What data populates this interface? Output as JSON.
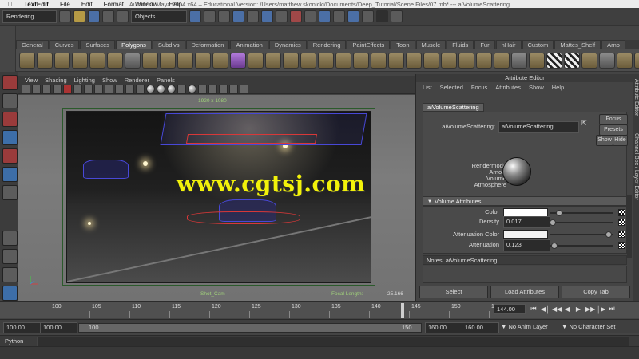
{
  "mac_menu": {
    "app": "TextEdit",
    "items": [
      "File",
      "Edit",
      "Format",
      "Window",
      "Help"
    ],
    "window_title": "Autodesk Maya 2014 x64 – Educational Version: /Users/matthew.skonicki/Documents/Deep_Tutorial/Scene Files/07.mb*   ---   aiVolumeScattering"
  },
  "status_line": {
    "menu_set": "Rendering",
    "selection_mode": "Objects"
  },
  "shelf": {
    "tabs": [
      "General",
      "Curves",
      "Surfaces",
      "Polygons",
      "Subdivs",
      "Deformation",
      "Animation",
      "Dynamics",
      "Rendering",
      "PaintEffects",
      "Toon",
      "Muscle",
      "Fluids",
      "Fur",
      "nHair",
      "Custom",
      "Mattes_Shelf",
      "Arno"
    ],
    "active_tab": "Polygons"
  },
  "viewport": {
    "menu": [
      "View",
      "Shading",
      "Lighting",
      "Show",
      "Renderer",
      "Panels"
    ],
    "resolution": "1920 x 1080",
    "camera_name": "Shot_Cam",
    "focal_label": "Focal Length:",
    "focal_value": "25.166",
    "watermark": "www.cgtsj.com"
  },
  "attribute_editor": {
    "title": "Attribute Editor",
    "menu": [
      "List",
      "Selected",
      "Focus",
      "Attributes",
      "Show",
      "Help"
    ],
    "tab": "aiVolumeScattering",
    "node_label": "aiVolumeScattering:",
    "node_value": "aiVolumeScattering",
    "focus_button": "Focus",
    "presets_button": "Presets",
    "show_button": "Show",
    "hide_button": "Hide",
    "swatch_lines": [
      "Rendermode",
      "Arnold",
      "Volume",
      "Atmosphere"
    ],
    "section_title": "Volume Attributes",
    "attrs": {
      "color_label": "Color",
      "density_label": "Density",
      "density_value": "0.017",
      "atten_color_label": "Attenuation Color",
      "atten_label": "Attenuation",
      "atten_value": "0.123"
    },
    "notes_label": "Notes:  aiVolumeScattering",
    "buttons": [
      "Select",
      "Load Attributes",
      "Copy Tab"
    ],
    "side_tabs": [
      "Attribute Editor",
      "Channel Box / Layer Editor"
    ]
  },
  "time_slider": {
    "ticks": [
      "100",
      "105",
      "110",
      "115",
      "120",
      "125",
      "130",
      "135",
      "140",
      "145",
      "150",
      "155"
    ],
    "current_frame": "144.00"
  },
  "range_slider": {
    "start_time": "100.00",
    "playback_start": "100.00",
    "range_start_label": "100",
    "range_end_label": "150",
    "playback_end": "160.00",
    "end_time": "160.00",
    "anim_layer": "No Anim Layer",
    "character_set": "No Character Set"
  },
  "command_line": {
    "language": "Python"
  }
}
